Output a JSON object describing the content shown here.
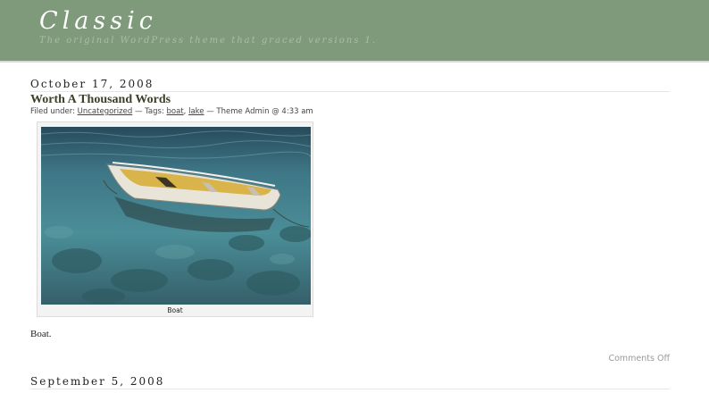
{
  "header": {
    "title": "Classic",
    "description": "The original WordPress theme that graced versions 1."
  },
  "post": {
    "date": "October 17, 2008",
    "title": "Worth A Thousand Words",
    "meta": {
      "filed_label": "Filed under:",
      "category": "Uncategorized",
      "tags_label": "— Tags:",
      "tag1": "boat",
      "tag_sep": ",",
      "tag2": "lake",
      "author_time": "— Theme Admin @ 4:33 am"
    },
    "image_caption": "Boat",
    "body": "Boat.",
    "comments": "Comments Off"
  },
  "next_post": {
    "date": "September 5, 2008"
  }
}
